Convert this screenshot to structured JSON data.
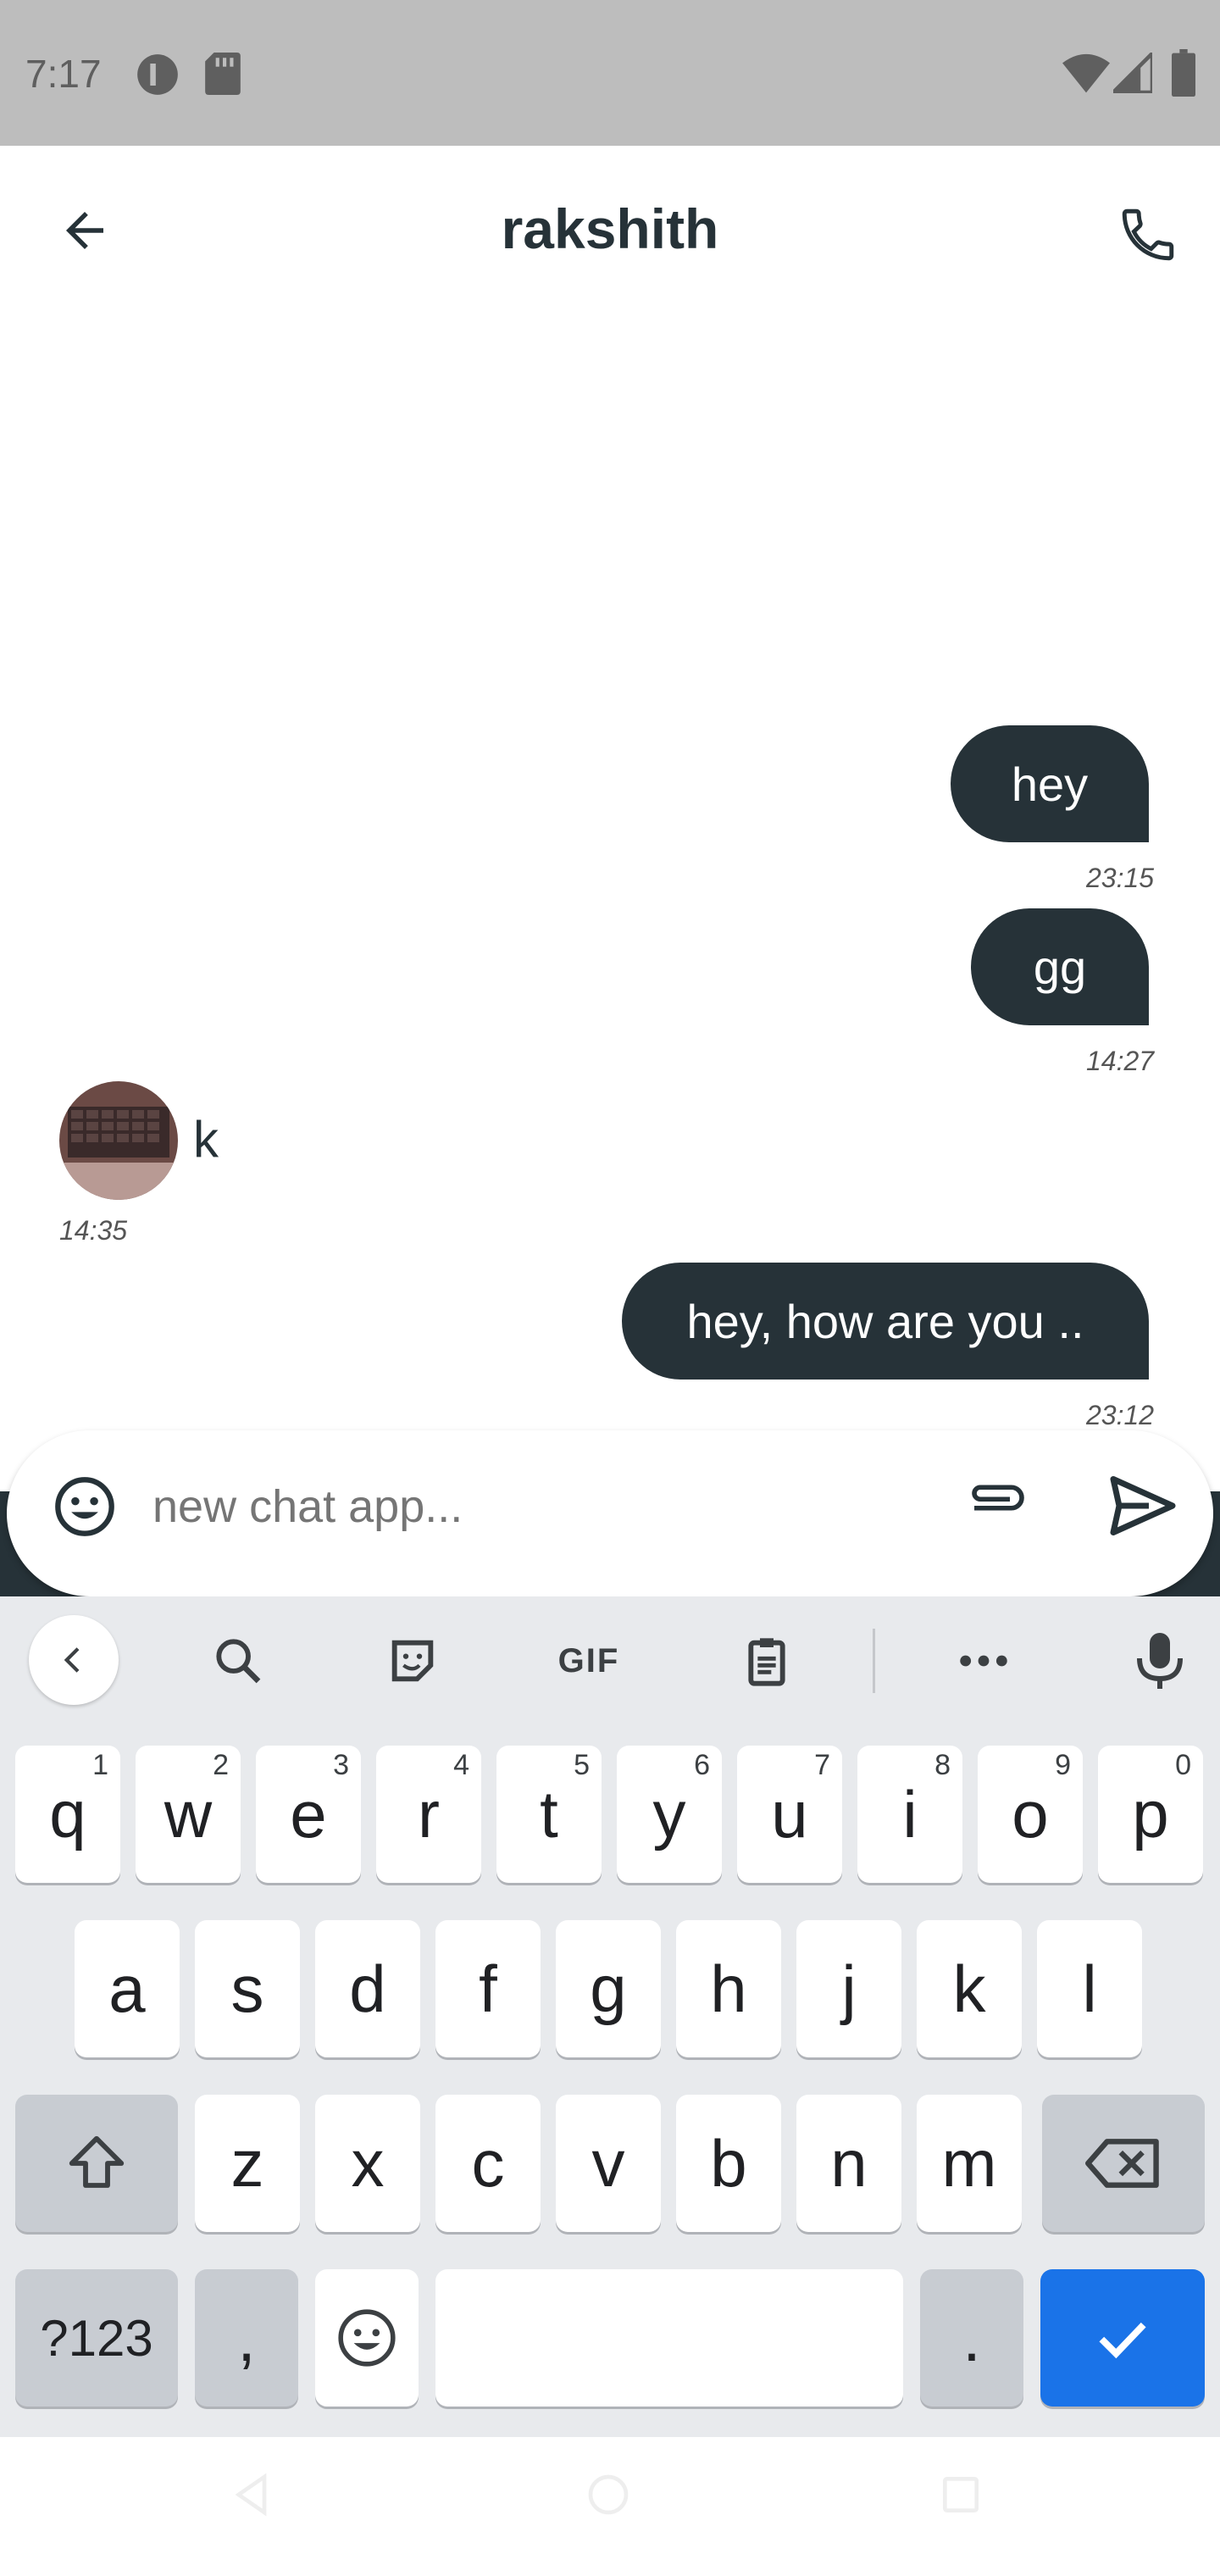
{
  "status_bar": {
    "time": "7:17",
    "icons": [
      "pause-circle-icon",
      "sd-card-icon",
      "wifi-icon",
      "signal-icon",
      "battery-icon"
    ]
  },
  "app_bar": {
    "title": "rakshith",
    "back_icon": "arrow-back-icon",
    "call_icon": "phone-icon"
  },
  "messages": [
    {
      "direction": "outgoing",
      "text": "hey",
      "time": "23:15"
    },
    {
      "direction": "outgoing",
      "text": "gg",
      "time": "14:27"
    },
    {
      "direction": "incoming",
      "text": "k",
      "time": "14:35"
    },
    {
      "direction": "outgoing",
      "text": "hey, how are you ..",
      "time": "23:12"
    }
  ],
  "composer": {
    "placeholder": "new chat app...",
    "value": ""
  },
  "keyboard": {
    "toolbar": [
      "collapse-icon",
      "search-icon",
      "sticker-icon",
      "GIF",
      "clipboard-icon",
      "more-icon",
      "mic-icon"
    ],
    "gif_label": "GIF",
    "row1": [
      {
        "k": "q",
        "h": "1"
      },
      {
        "k": "w",
        "h": "2"
      },
      {
        "k": "e",
        "h": "3"
      },
      {
        "k": "r",
        "h": "4"
      },
      {
        "k": "t",
        "h": "5"
      },
      {
        "k": "y",
        "h": "6"
      },
      {
        "k": "u",
        "h": "7"
      },
      {
        "k": "i",
        "h": "8"
      },
      {
        "k": "o",
        "h": "9"
      },
      {
        "k": "p",
        "h": "0"
      }
    ],
    "row2": [
      "a",
      "s",
      "d",
      "f",
      "g",
      "h",
      "j",
      "k",
      "l"
    ],
    "row3": [
      "z",
      "x",
      "c",
      "v",
      "b",
      "n",
      "m"
    ],
    "symbols_label": "?123",
    "comma": ",",
    "period": "."
  },
  "colors": {
    "primary": "#263238",
    "accent": "#1a73e8",
    "keyboard_bg": "#e8eaed"
  }
}
